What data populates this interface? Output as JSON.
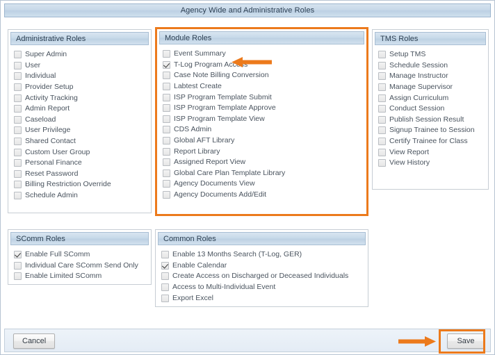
{
  "header": {
    "title": "Agency Wide and Administrative Roles"
  },
  "panels": {
    "administrative": {
      "title": "Administrative Roles",
      "items": [
        {
          "label": "Super Admin",
          "checked": false
        },
        {
          "label": "User",
          "checked": false
        },
        {
          "label": "Individual",
          "checked": false
        },
        {
          "label": "Provider Setup",
          "checked": false
        },
        {
          "label": "Activity Tracking",
          "checked": false
        },
        {
          "label": "Admin Report",
          "checked": false
        },
        {
          "label": "Caseload",
          "checked": false
        },
        {
          "label": "User Privilege",
          "checked": false
        },
        {
          "label": "Shared Contact",
          "checked": false
        },
        {
          "label": "Custom User Group",
          "checked": false
        },
        {
          "label": "Personal Finance",
          "checked": false
        },
        {
          "label": "Reset Password",
          "checked": false
        },
        {
          "label": "Billing Restriction Override",
          "checked": false
        },
        {
          "label": "Schedule Admin",
          "checked": false
        }
      ]
    },
    "module": {
      "title": "Module Roles",
      "highlighted": true,
      "items": [
        {
          "label": "Event Summary",
          "checked": false
        },
        {
          "label": "T-Log Program Access",
          "checked": true,
          "annotated": true
        },
        {
          "label": "Case Note Billing Conversion",
          "checked": false
        },
        {
          "label": "Labtest Create",
          "checked": false
        },
        {
          "label": "ISP Program Template Submit",
          "checked": false
        },
        {
          "label": "ISP Program Template Approve",
          "checked": false
        },
        {
          "label": "ISP Program Template View",
          "checked": false
        },
        {
          "label": "CDS Admin",
          "checked": false
        },
        {
          "label": "Global AFT Library",
          "checked": false
        },
        {
          "label": "Report Library",
          "checked": false
        },
        {
          "label": "Assigned Report View",
          "checked": false
        },
        {
          "label": "Global Care Plan Template Library",
          "checked": false
        },
        {
          "label": "Agency Documents View",
          "checked": false
        },
        {
          "label": "Agency Documents Add/Edit",
          "checked": false
        }
      ]
    },
    "tms": {
      "title": "TMS Roles",
      "items": [
        {
          "label": "Setup TMS",
          "checked": false
        },
        {
          "label": "Schedule Session",
          "checked": false
        },
        {
          "label": "Manage Instructor",
          "checked": false
        },
        {
          "label": "Manage Supervisor",
          "checked": false
        },
        {
          "label": "Assign Curriculum",
          "checked": false
        },
        {
          "label": "Conduct Session",
          "checked": false
        },
        {
          "label": "Publish Session Result",
          "checked": false
        },
        {
          "label": "Signup Trainee to Session",
          "checked": false
        },
        {
          "label": "Certify Trainee for Class",
          "checked": false
        },
        {
          "label": "View Report",
          "checked": false
        },
        {
          "label": "View History",
          "checked": false
        }
      ]
    },
    "scomm": {
      "title": "SComm Roles",
      "items": [
        {
          "label": "Enable Full SComm",
          "checked": true
        },
        {
          "label": "Individual Care SComm Send Only",
          "checked": false
        },
        {
          "label": "Enable Limited SComm",
          "checked": false
        }
      ]
    },
    "common": {
      "title": "Common Roles",
      "items": [
        {
          "label": "Enable 13 Months Search (T-Log, GER)",
          "checked": false
        },
        {
          "label": "Enable Calendar",
          "checked": true
        },
        {
          "label": "Create Access on Discharged or Deceased Individuals",
          "checked": false
        },
        {
          "label": "Access to Multi-Individual Event",
          "checked": false
        },
        {
          "label": "Export Excel",
          "checked": false
        }
      ]
    }
  },
  "footer": {
    "cancel_label": "Cancel",
    "save_label": "Save",
    "save_highlighted": true
  },
  "annotations": {
    "accent_color": "#ec7a1c",
    "module_arrow": "left-pointing-arrow",
    "save_arrow": "right-pointing-arrow"
  }
}
